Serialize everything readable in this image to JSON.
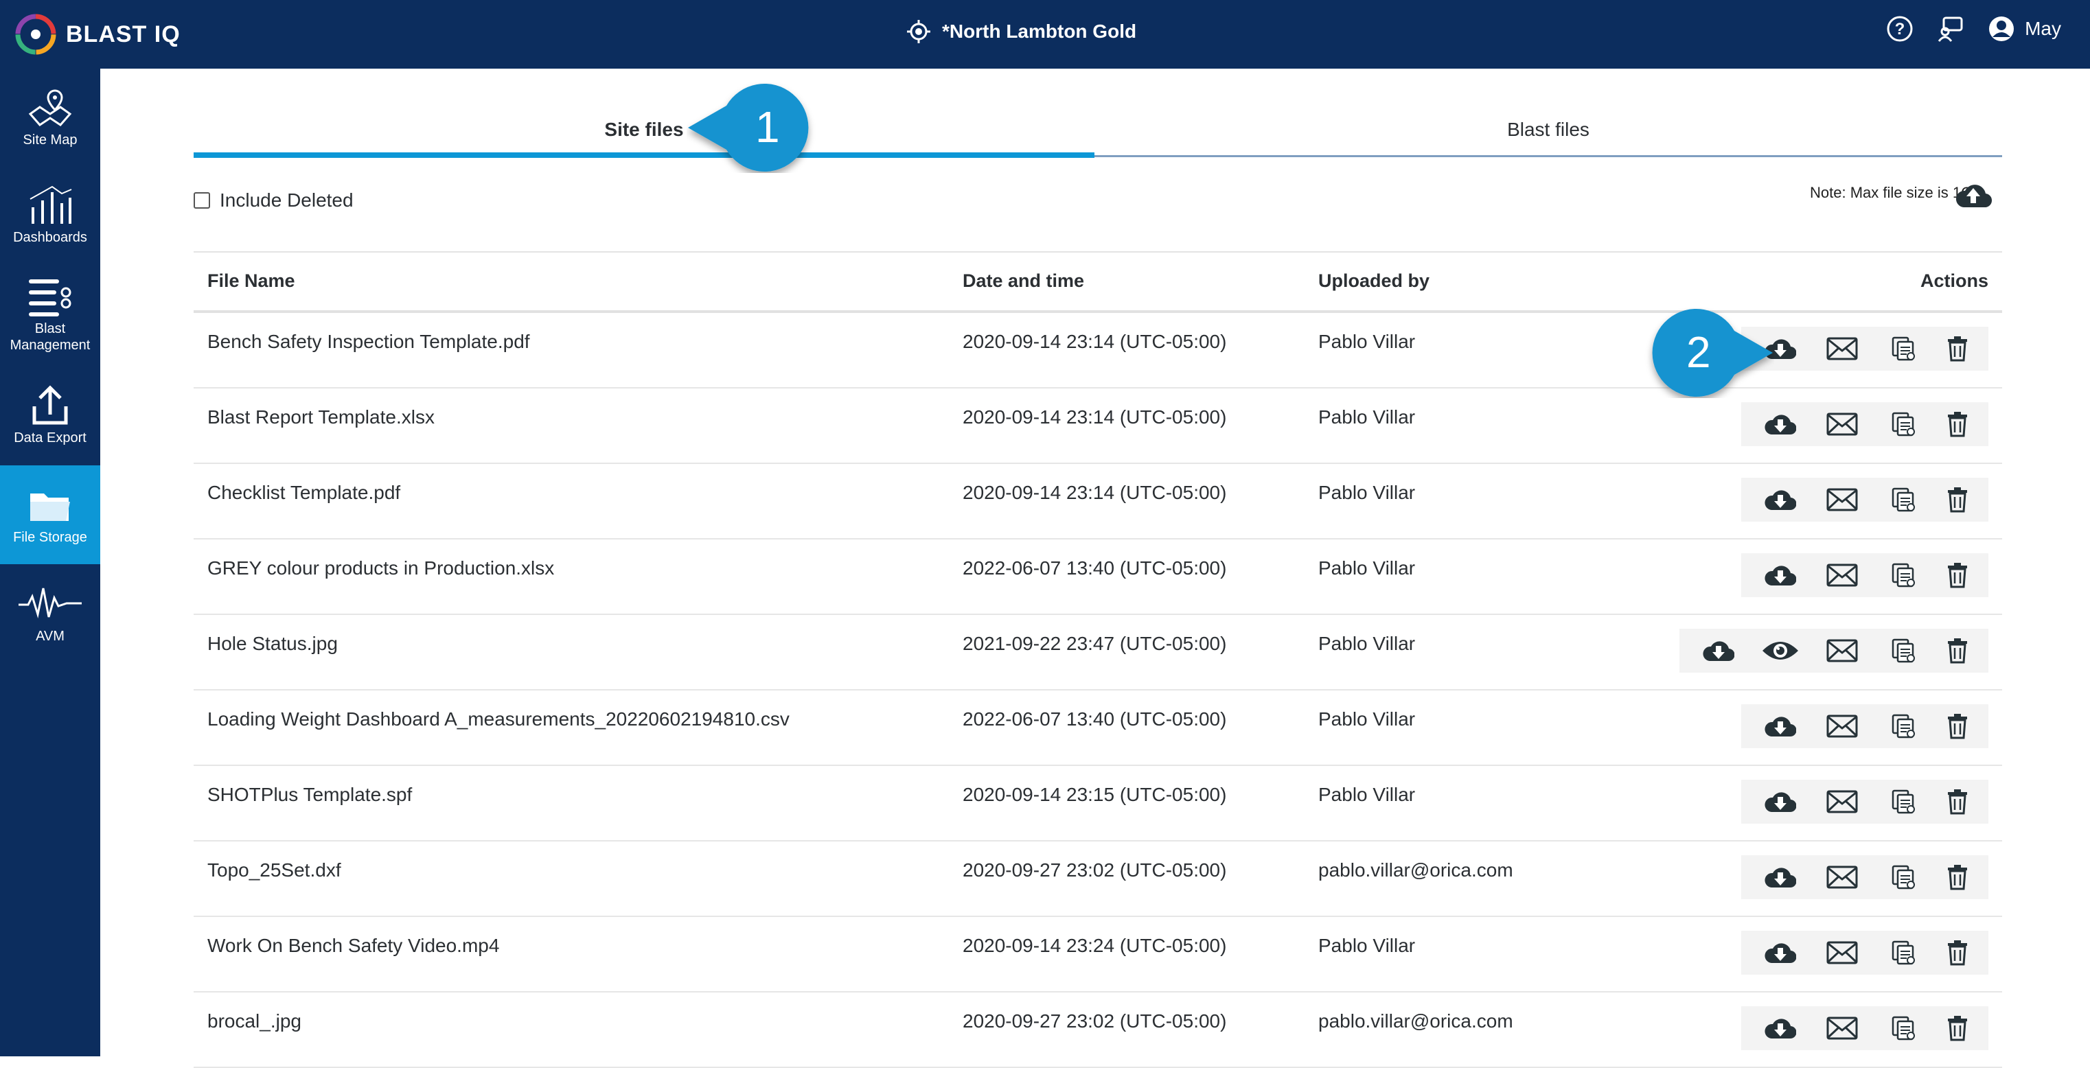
{
  "app": {
    "brand": "BLAST IQ",
    "site_title": "*North Lambton Gold",
    "user_name": "May"
  },
  "sidebar": {
    "items": [
      {
        "label": "Site Map",
        "icon": "map-icon"
      },
      {
        "label": "Dashboards",
        "icon": "dashboard-icon"
      },
      {
        "label": "Blast Management",
        "icon": "blast-management-icon"
      },
      {
        "label": "Data Export",
        "icon": "export-icon"
      },
      {
        "label": "File Storage",
        "icon": "folder-icon",
        "active": true
      },
      {
        "label": "AVM",
        "icon": "waveform-icon"
      }
    ]
  },
  "tabs": [
    {
      "label": "Site files",
      "active": true
    },
    {
      "label": "Blast files",
      "active": false
    }
  ],
  "callouts": [
    "1",
    "2"
  ],
  "filters": {
    "include_deleted_label": "Include Deleted"
  },
  "note": "Note: Max file size is 1GB.",
  "table": {
    "columns": [
      "File Name",
      "Date and time",
      "Uploaded by",
      "Actions"
    ],
    "rows": [
      {
        "name": "Bench Safety Inspection Template.pdf",
        "date": "2020-09-14 23:14 (UTC-05:00)",
        "user": "Pablo Villar",
        "preview": false
      },
      {
        "name": "Blast Report Template.xlsx",
        "date": "2020-09-14 23:14 (UTC-05:00)",
        "user": "Pablo Villar",
        "preview": false
      },
      {
        "name": "Checklist Template.pdf",
        "date": "2020-09-14 23:14 (UTC-05:00)",
        "user": "Pablo Villar",
        "preview": false
      },
      {
        "name": "GREY colour products in Production.xlsx",
        "date": "2022-06-07 13:40 (UTC-05:00)",
        "user": "Pablo Villar",
        "preview": false
      },
      {
        "name": "Hole Status.jpg",
        "date": "2021-09-22 23:47 (UTC-05:00)",
        "user": "Pablo Villar",
        "preview": true
      },
      {
        "name": "Loading Weight Dashboard A_measurements_20220602194810.csv",
        "date": "2022-06-07 13:40 (UTC-05:00)",
        "user": "Pablo Villar",
        "preview": false
      },
      {
        "name": "SHOTPlus Template.spf",
        "date": "2020-09-14 23:15 (UTC-05:00)",
        "user": "Pablo Villar",
        "preview": false
      },
      {
        "name": "Topo_25Set.dxf",
        "date": "2020-09-27 23:02 (UTC-05:00)",
        "user": "pablo.villar@orica.com",
        "preview": false
      },
      {
        "name": "Work On Bench Safety Video.mp4",
        "date": "2020-09-14 23:24 (UTC-05:00)",
        "user": "Pablo Villar",
        "preview": false
      },
      {
        "name": "brocal_.jpg",
        "date": "2020-09-27 23:02 (UTC-05:00)",
        "user": "pablo.villar@orica.com",
        "preview": false
      }
    ]
  },
  "colors": {
    "navy": "#0c2d5e",
    "accent": "#0d97d6",
    "callout": "#1593d0"
  }
}
